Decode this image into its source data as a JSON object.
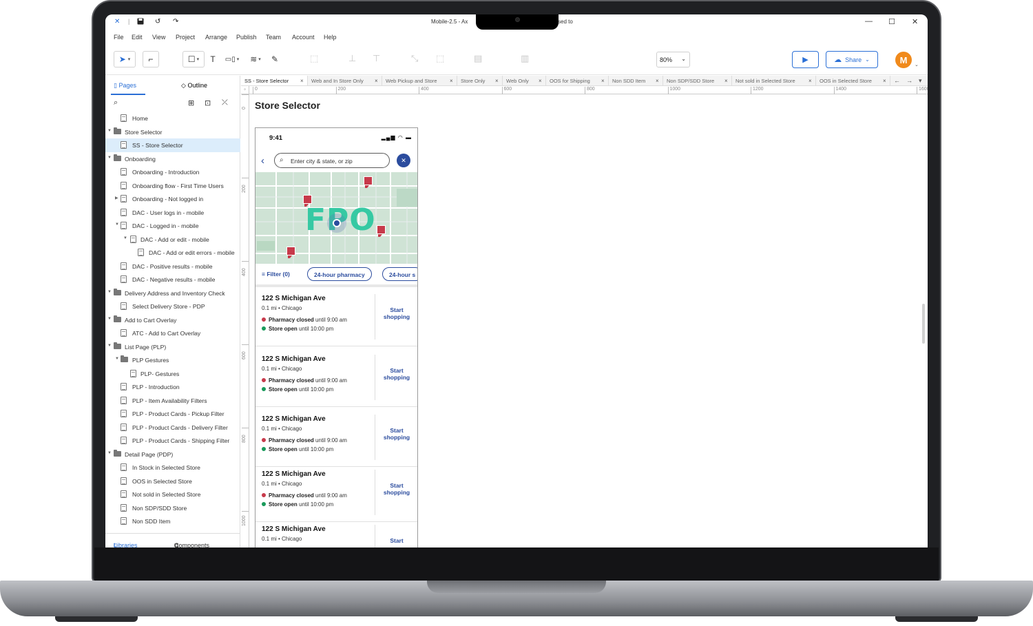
{
  "window": {
    "title_left": "Mobile-2.5 - Ax",
    "title_right": "sed to",
    "controls": [
      "—",
      "☐",
      "✕"
    ]
  },
  "titlebar_icons": [
    "axure-logo-icon",
    "save-icon",
    "undo-icon",
    "redo-icon"
  ],
  "menu": [
    "File",
    "Edit",
    "View",
    "Project",
    "Arrange",
    "Publish",
    "Team",
    "Account",
    "Help"
  ],
  "toolbar": {
    "zoom": "80%",
    "share_label": "Share",
    "avatar_initial": "M",
    "accent": "#2a6fd6",
    "avatar_color": "#f08a1c"
  },
  "left_panel": {
    "tab_pages": "Pages",
    "tab_outline": "Outline",
    "footer_libraries": "Libraries",
    "footer_components": "Components",
    "items": [
      {
        "label": "Home",
        "level": 1,
        "type": "page",
        "toggle": ""
      },
      {
        "label": "Store Selector",
        "level": 0,
        "type": "folder",
        "toggle": "▼"
      },
      {
        "label": "SS - Store Selector",
        "level": 2,
        "type": "page",
        "toggle": "",
        "selected": true
      },
      {
        "label": "Onboarding",
        "level": 0,
        "type": "folder",
        "toggle": "▼"
      },
      {
        "label": "Onboarding - Introduction",
        "level": 2,
        "type": "page",
        "toggle": ""
      },
      {
        "label": "Onboarding flow - First Time Users",
        "level": 2,
        "type": "page",
        "toggle": ""
      },
      {
        "label": "Onboarding - Not logged in",
        "level": 2,
        "type": "page",
        "toggle": "▶"
      },
      {
        "label": "DAC - User logs in - mobile",
        "level": 2,
        "type": "page",
        "toggle": ""
      },
      {
        "label": "DAC - Logged in - mobile",
        "level": 2,
        "type": "page",
        "toggle": "▼"
      },
      {
        "label": "DAC - Add or edit - mobile",
        "level": 3,
        "type": "page",
        "toggle": "▼"
      },
      {
        "label": "DAC - Add or edit errors - mobile",
        "level": 4,
        "type": "page",
        "toggle": ""
      },
      {
        "label": "DAC - Positive results - mobile",
        "level": 2,
        "type": "page",
        "toggle": ""
      },
      {
        "label": "DAC - Negative results - mobile",
        "level": 2,
        "type": "page",
        "toggle": ""
      },
      {
        "label": "Delivery Address and Inventory Check",
        "level": 0,
        "type": "folder",
        "toggle": "▼"
      },
      {
        "label": "Select Delivery Store - PDP",
        "level": 2,
        "type": "page",
        "toggle": ""
      },
      {
        "label": "Add to Cart Overlay",
        "level": 0,
        "type": "folder",
        "toggle": "▼"
      },
      {
        "label": "ATC - Add to Cart Overlay",
        "level": 2,
        "type": "page",
        "toggle": ""
      },
      {
        "label": "List Page (PLP)",
        "level": 0,
        "type": "folder",
        "toggle": "▼"
      },
      {
        "label": "PLP Gestures",
        "level": 1,
        "type": "folder",
        "toggle": "▼"
      },
      {
        "label": "PLP- Gestures",
        "level": 3,
        "type": "page",
        "toggle": ""
      },
      {
        "label": "PLP - Introduction",
        "level": 2,
        "type": "page",
        "toggle": ""
      },
      {
        "label": "PLP - Item Availability Filters",
        "level": 2,
        "type": "page",
        "toggle": ""
      },
      {
        "label": "PLP - Product Cards - Pickup Filter",
        "level": 2,
        "type": "page",
        "toggle": ""
      },
      {
        "label": "PLP - Product Cards - Delivery Filter",
        "level": 2,
        "type": "page",
        "toggle": ""
      },
      {
        "label": "PLP - Product Cards - Shipping Filter",
        "level": 2,
        "type": "page",
        "toggle": ""
      },
      {
        "label": "Detail Page (PDP)",
        "level": 0,
        "type": "folder",
        "toggle": "▼"
      },
      {
        "label": "In Stock in Selected Store",
        "level": 2,
        "type": "page",
        "toggle": ""
      },
      {
        "label": "OOS in Selected Store",
        "level": 2,
        "type": "page",
        "toggle": ""
      },
      {
        "label": "Not sold in Selected Store",
        "level": 2,
        "type": "page",
        "toggle": ""
      },
      {
        "label": "Non SDP/SDD Store",
        "level": 2,
        "type": "page",
        "toggle": ""
      },
      {
        "label": "Non SDD Item",
        "level": 2,
        "type": "page",
        "toggle": ""
      }
    ]
  },
  "doc_tabs": [
    "SS - Store Selector",
    "Web and In Store Only",
    "Web Pickup and Store",
    "Store Only",
    "Web Only",
    "OOS for Shipping",
    "Non SDD Item",
    "Non SDP/SDD Store",
    "Not sold in Selected Store",
    "OOS in Selected Store"
  ],
  "ruler": {
    "h": [
      "0",
      "200",
      "400",
      "600",
      "800",
      "1000",
      "1200",
      "1400",
      "1600"
    ],
    "v": [
      "0",
      "200",
      "400",
      "600",
      "800",
      "1000"
    ]
  },
  "canvas": {
    "title": "Store Selector"
  },
  "phone": {
    "time": "9:41",
    "search_placeholder": "Enter city & state, or zip",
    "map_label": "FPO",
    "filter_label": "Filter (0)",
    "chips": [
      "24-hour pharmacy",
      "24-hour s"
    ],
    "stores": [
      {
        "name": "122 S Michigan Ave",
        "dist": "0.1 mi • Chicago",
        "pharmacy_status": "Pharmacy closed",
        "pharmacy_time": "until 9:00 am",
        "store_status": "Store open",
        "store_time": "until 10:00 pm",
        "cta": "Start shopping"
      },
      {
        "name": "122 S Michigan Ave",
        "dist": "0.1 mi • Chicago",
        "pharmacy_status": "Pharmacy closed",
        "pharmacy_time": "until 9:00 am",
        "store_status": "Store open",
        "store_time": "until 10:00 pm",
        "cta": "Start shopping"
      },
      {
        "name": "122 S Michigan Ave",
        "dist": "0.1 mi • Chicago",
        "pharmacy_status": "Pharmacy closed",
        "pharmacy_time": "until 9:00 am",
        "store_status": "Store open",
        "store_time": "until 10:00 pm",
        "cta": "Start shopping"
      },
      {
        "name": "122 S Michigan Ave",
        "dist": "0.1 mi • Chicago",
        "pharmacy_status": "Pharmacy closed",
        "pharmacy_time": "until 9:00 am",
        "store_status": "Store open",
        "store_time": "until 10:00 pm",
        "cta": "Start shopping"
      },
      {
        "name": "122 S Michigan Ave",
        "dist": "0.1 mi • Chicago",
        "pharmacy_status": "",
        "pharmacy_time": "",
        "store_status": "",
        "store_time": "",
        "cta": "Start"
      }
    ],
    "closed_color": "#c73a4b",
    "open_color": "#1a9a5b",
    "brand_color": "#2b4c9e"
  }
}
